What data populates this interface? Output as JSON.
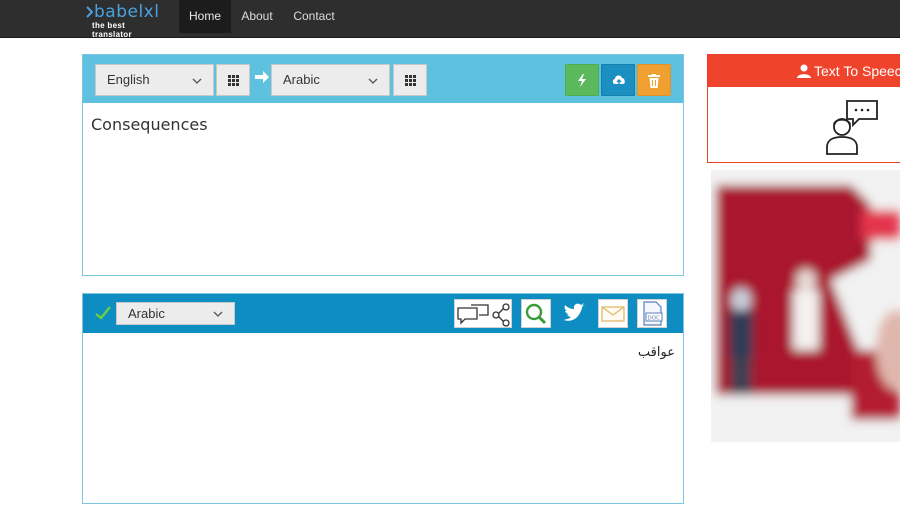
{
  "navbar": {
    "logo_text": "babelxl",
    "logo_tagline": "the best translator",
    "items": [
      {
        "label": "Home",
        "active": true
      },
      {
        "label": "About",
        "active": false
      },
      {
        "label": "Contact",
        "active": false
      }
    ]
  },
  "source": {
    "language": "English",
    "target_language": "Arabic",
    "text": "Consequences",
    "icons": {
      "grid": "grid-icon",
      "arrow": "arrow-right-icon",
      "translate": "lightning-icon",
      "upload": "cloud-upload-icon",
      "delete": "trash-icon"
    }
  },
  "target": {
    "language": "Arabic",
    "text": "عواقب",
    "icons": [
      "check-icon",
      "chat-share-icon",
      "search-icon",
      "twitter-icon",
      "email-icon",
      "doc-icon"
    ]
  },
  "tts": {
    "label": "Text To Speech"
  },
  "colors": {
    "source_toolbar": "#5fc1e0",
    "target_toolbar": "#0e8dc2",
    "tts_header": "#f0432b",
    "green": "#5cb85c",
    "blue": "#1b8fc1",
    "orange": "#f0a030"
  }
}
